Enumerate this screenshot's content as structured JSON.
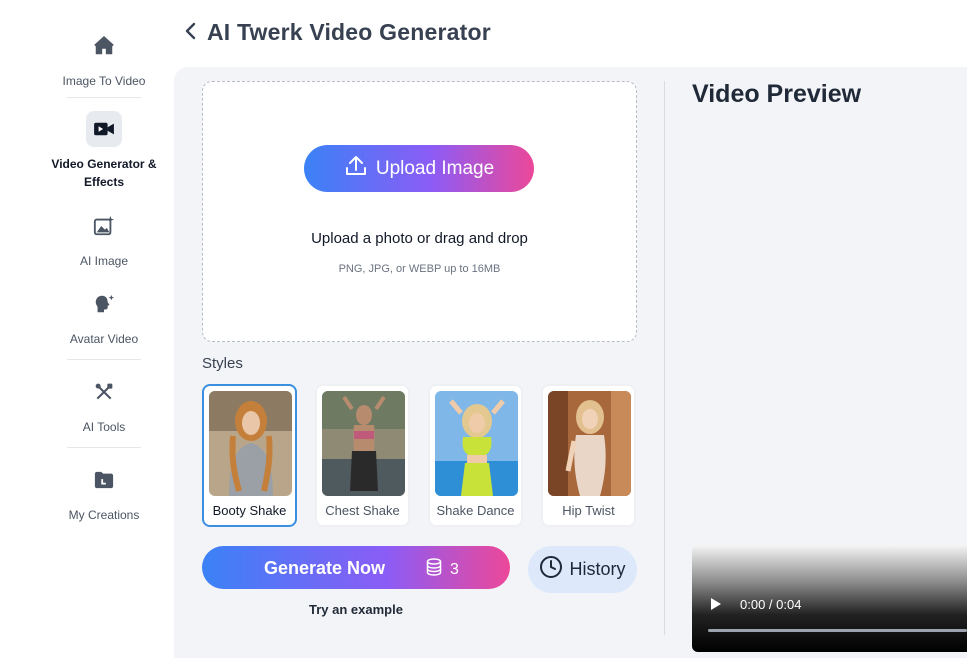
{
  "sidebar": {
    "items": [
      {
        "label": "Image To Video",
        "icon": "home-icon"
      },
      {
        "label": "Video Generator & Effects",
        "icon": "video-camera-icon",
        "active": true
      },
      {
        "label": "AI Image",
        "icon": "ai-image-icon"
      },
      {
        "label": "Avatar Video",
        "icon": "avatar-head-icon"
      },
      {
        "label": "AI Tools",
        "icon": "tools-icon"
      },
      {
        "label": "My Creations",
        "icon": "folder-icon"
      }
    ]
  },
  "header": {
    "title": "AI Twerk Video Generator"
  },
  "upload": {
    "button_label": "Upload Image",
    "hint": "Upload a photo or drag and drop",
    "formats": "PNG, JPG, or WEBP up to 16MB"
  },
  "styles": {
    "label": "Styles",
    "cards": [
      {
        "name": "Booty Shake",
        "selected": true
      },
      {
        "name": "Chest Shake",
        "selected": false
      },
      {
        "name": "Shake Dance",
        "selected": false
      },
      {
        "name": "Hip Twist",
        "selected": false
      }
    ]
  },
  "actions": {
    "generate_label": "Generate Now",
    "credit_cost": "3",
    "history_label": "History",
    "try_example": "Try an example"
  },
  "preview": {
    "title": "Video Preview",
    "time": "0:00 / 0:04",
    "progress": 0
  },
  "colors": {
    "accent_start": "#3b82f6",
    "accent_end": "#ec4899",
    "selected_border": "#3b8fe0"
  }
}
